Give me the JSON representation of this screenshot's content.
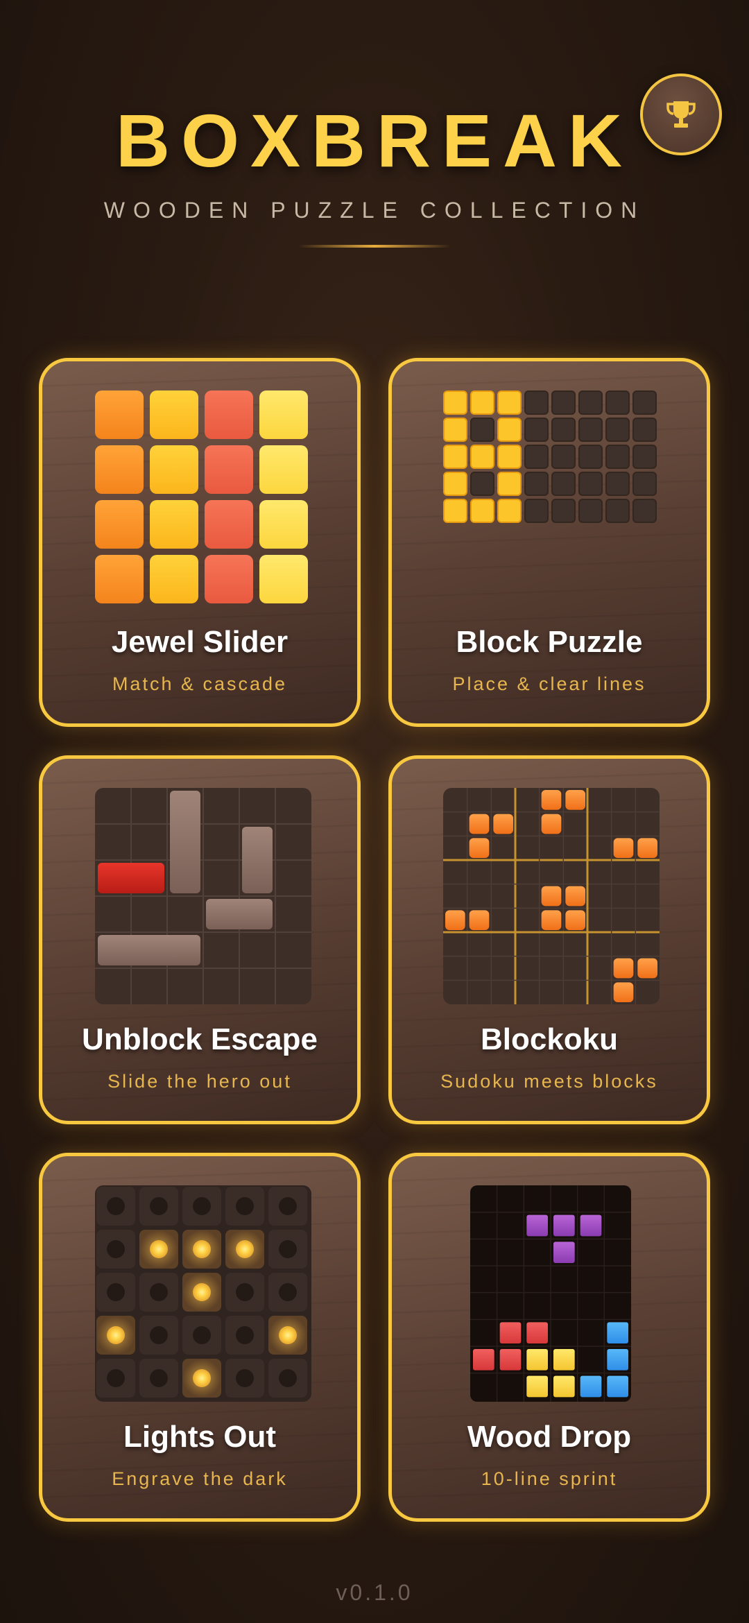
{
  "header": {
    "title": "BOXBREAK",
    "subtitle": "WOODEN PUZZLE COLLECTION",
    "trophy_icon": "trophy-icon"
  },
  "games": [
    {
      "title": "Jewel Slider",
      "subtitle": "Match & cascade"
    },
    {
      "title": "Block Puzzle",
      "subtitle": "Place & clear lines"
    },
    {
      "title": "Unblock Escape",
      "subtitle": "Slide the hero out"
    },
    {
      "title": "Blockoku",
      "subtitle": "Sudoku meets blocks"
    },
    {
      "title": "Lights Out",
      "subtitle": "Engrave the dark"
    },
    {
      "title": "Wood Drop",
      "subtitle": "10-line sprint"
    }
  ],
  "footer": {
    "version": "v0.1.0"
  },
  "colors": {
    "accent": "#fdd24a",
    "card_border": "#f8c840",
    "subtitle_gold": "#e7b64f"
  }
}
